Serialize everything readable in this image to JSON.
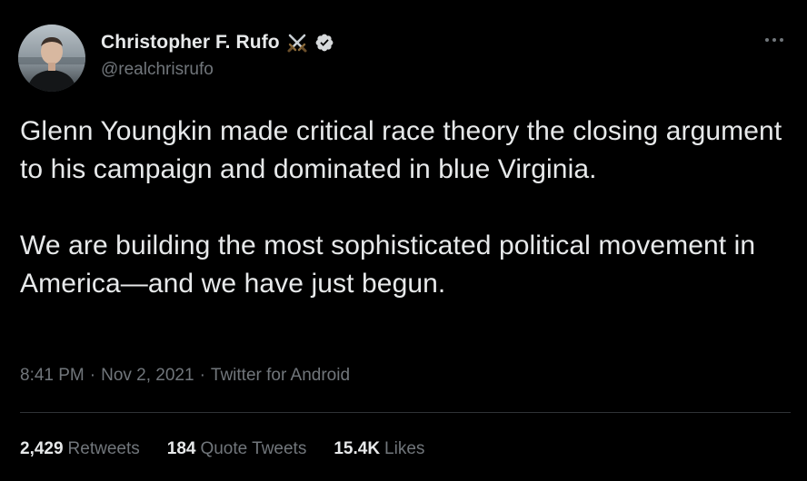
{
  "author": {
    "display_name": "Christopher F. Rufo",
    "handle": "@realchrisrufo",
    "name_emoji_icon": "crossed-swords-icon",
    "verified_icon": "verified-badge-icon"
  },
  "more_icon": "more-horizontal-icon",
  "tweet": {
    "text_paragraph_1": "Glenn Youngkin made critical race theory the closing argument to his campaign and dominated in blue Virginia.",
    "text_paragraph_2": "We are building the most sophisticated political movement in America—and we have just begun."
  },
  "meta": {
    "time": "8:41 PM",
    "separator": "·",
    "date": "Nov 2, 2021",
    "source": "Twitter for Android"
  },
  "stats": {
    "retweets_count": "2,429",
    "retweets_label": "Retweets",
    "quote_tweets_count": "184",
    "quote_tweets_label": "Quote Tweets",
    "likes_count": "15.4K",
    "likes_label": "Likes"
  },
  "colors": {
    "background": "#000000",
    "primary_text": "#e7e9ea",
    "secondary_text": "#71767b",
    "divider": "#2f3336",
    "verified_badge": "#d6d9db"
  }
}
